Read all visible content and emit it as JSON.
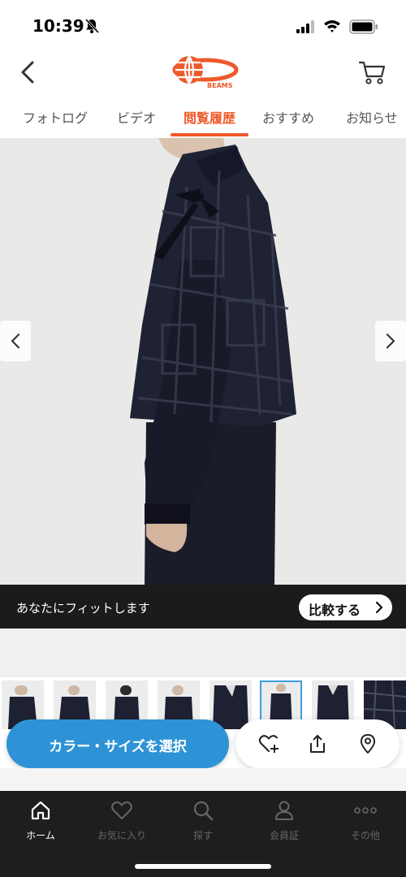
{
  "status_bar": {
    "time": "10:39",
    "icons": [
      "bell-off-icon",
      "signal-icon",
      "wifi-icon",
      "battery-icon"
    ]
  },
  "header": {
    "logo_text": "BEAMS",
    "back_icon": "chevron-left-icon",
    "cart_icon": "cart-icon"
  },
  "tabs": [
    {
      "label": "フォトログ",
      "active": false
    },
    {
      "label": "ビデオ",
      "active": false
    },
    {
      "label": "閲覧履歴",
      "active": true
    },
    {
      "label": "おすすめ",
      "active": false
    },
    {
      "label": "お知らせ",
      "active": false
    }
  ],
  "hero": {
    "prev_icon": "chevron-left-icon",
    "next_icon": "chevron-right-icon"
  },
  "fit_bar": {
    "text": "あなたにフィットします",
    "compare_label": "比較する"
  },
  "thumbnails": {
    "count": 8,
    "selected_index": 5
  },
  "actions": {
    "select_label": "カラー・サイズを選択",
    "icons": [
      "favorite-add-icon",
      "share-icon",
      "location-icon"
    ]
  },
  "tabbar": {
    "items": [
      {
        "label": "ホーム",
        "icon": "home-icon",
        "active": true
      },
      {
        "label": "お気に入り",
        "icon": "heart-icon",
        "active": false
      },
      {
        "label": "探す",
        "icon": "search-icon",
        "active": false
      },
      {
        "label": "会員証",
        "icon": "person-icon",
        "active": false
      },
      {
        "label": "その他",
        "icon": "more-icon",
        "active": false
      }
    ]
  },
  "colors": {
    "accent": "#ee5a2a",
    "primary_button": "#2e93d6",
    "tabbar_bg": "#1e1e1e",
    "fit_bar_bg": "#1b1b1b"
  }
}
